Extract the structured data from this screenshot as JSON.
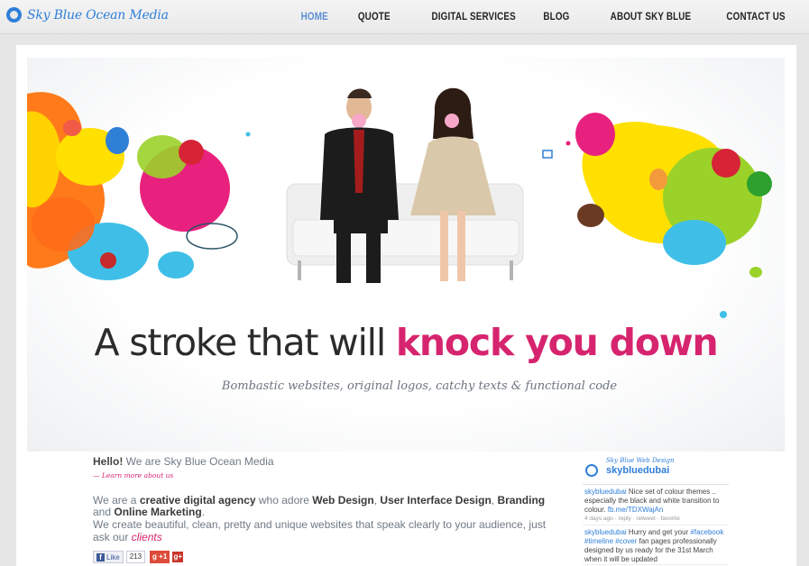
{
  "header": {
    "logo_text": "Sky Blue Ocean Media",
    "nav": [
      "HOME",
      "QUOTE",
      "DIGITAL SERVICES",
      "BLOG",
      "ABOUT SKY BLUE",
      "CONTACT US"
    ],
    "active_nav": "HOME",
    "accent_color": "#2f7fd8"
  },
  "hero": {
    "headline_plain": "A stroke that will",
    "headline_strong": "knock you down",
    "tagline": "Bombastic websites, original logos, catchy texts & functional code",
    "highlight_color": "#d6246e"
  },
  "intro": {
    "hello": "Hello!",
    "hello_rest": " We are Sky Blue Ocean Media",
    "learn_more": "— Learn more about us",
    "p1": {
      "t1": "We are a ",
      "b1": "creative digital agency",
      "t2": " who adore ",
      "b2": "Web Design",
      "t3": ", ",
      "b3": "User Interface Design",
      "t4": ", ",
      "b4": "Branding",
      "t5": " and ",
      "b5": "Online Marketing",
      "t6": "."
    },
    "p2_text": "We create beautiful, clean, pretty and unique websites that speak clearly to your audience, just ask our ",
    "p2_link": "clients"
  },
  "social": {
    "fb_label": "Like",
    "fb_count": "213",
    "gplus_label": "g +1",
    "gplus_badge": "g+"
  },
  "twitter": {
    "subtitle": "Sky Blue Web Design",
    "name": "skybluedubai",
    "tweets": [
      {
        "user": "skybluedubai",
        "text": " Nice set of colour themes .. especially the black and white transition to colour. ",
        "link": "fb.me/TDXWajAn",
        "meta": "4 days ago · reply · retweet · favorite"
      },
      {
        "user": "skybluedubai",
        "text_a": " Hurry and get your ",
        "tag1": "#facebook",
        "tag2": "#timeline",
        "tag3": "#cover",
        "text_b": " fan pages professionally designed by us ready for the 31st March when it will be updated"
      }
    ]
  }
}
